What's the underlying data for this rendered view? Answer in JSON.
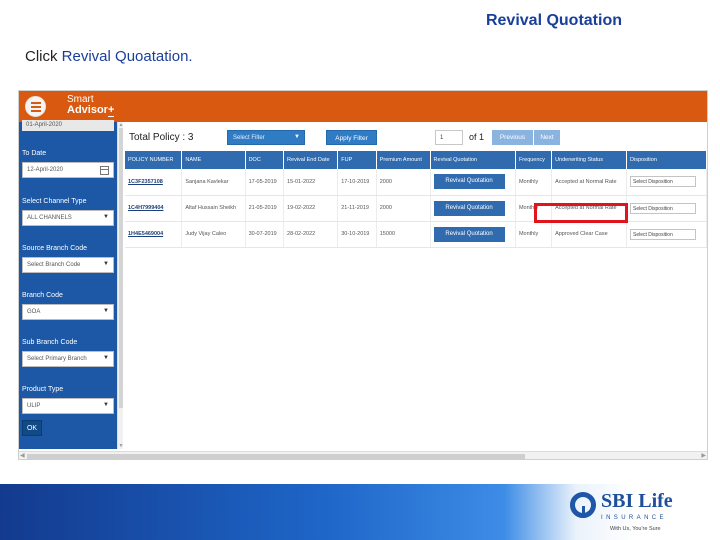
{
  "slide": {
    "title": "Revival Quotation",
    "instruction_prefix": "Click ",
    "instruction_highlight": "Revival Quoatation."
  },
  "app": {
    "brand_line1": "Smart",
    "brand_line2": "Advisor",
    "brand_plus": "+",
    "colors": {
      "topbar": "#d8590f",
      "sidebar": "#1c58a5",
      "table_header": "#2f6bae",
      "highlight": "#e0141c"
    }
  },
  "sidebar": {
    "from_date_value": "01-April-2020",
    "to_date_label": "To Date",
    "to_date_value": "12-April-2020",
    "channel_type_label": "Select Channel Type",
    "channel_type_value": "ALL CHANNELS",
    "source_branch_label": "Source Branch Code",
    "source_branch_value": "Select Branch Code",
    "branch_code_label": "Branch Code",
    "branch_code_value": "GOA",
    "sub_branch_label": "Sub Branch Code",
    "sub_branch_value": "Select Primary Branch",
    "product_type_label": "Product Type",
    "product_type_value": "ULIP",
    "ok_label": "OK"
  },
  "toolbar": {
    "total_policy": "Total Policy : 3",
    "filter_placeholder": "Select Filter",
    "apply_label": "Apply Filter",
    "page_value": "1",
    "of_text": "of 1",
    "previous_label": "Previous",
    "next_label": "Next"
  },
  "table": {
    "headers": [
      "POLICY NUMBER",
      "NAME",
      "DOC",
      "Revival End Date",
      "FUP",
      "Premium Amount",
      "Revival Quotation",
      "Frequency",
      "Underwriting Status",
      "Disposition"
    ],
    "rows": [
      {
        "policy": "1C3F2357108",
        "name": "Sanjana Kavlekar",
        "doc": "17-05-2019",
        "revival_end": "15-01-2022",
        "fup": "17-10-2019",
        "premium": "2000",
        "rq": "Revival Quotation",
        "frequency": "Monthly",
        "uw_status": "Accepted at Normal Rate",
        "disposition": "Select Disposition"
      },
      {
        "policy": "1C4H7999404",
        "name": "Altaf Hussain Sheikh",
        "doc": "21-05-2019",
        "revival_end": "19-02-2022",
        "fup": "21-11-2019",
        "premium": "2000",
        "rq": "Revival Quotation",
        "frequency": "Monthly",
        "uw_status": "Accepted at Normal Rate",
        "disposition": "Select Disposition"
      },
      {
        "policy": "1H4E5469004",
        "name": "Judy Vijay Caleo",
        "doc": "30-07-2019",
        "revival_end": "28-02-2022",
        "fup": "30-10-2019",
        "premium": "15000",
        "rq": "Revival Quotation",
        "frequency": "Monthly",
        "uw_status": "Approved Clear Case",
        "disposition": "Select Disposition"
      }
    ]
  },
  "footer": {
    "logo_name": "SBI Life",
    "logo_insurance": "INSURANCE",
    "logo_tagline": "With Us, You're Sure"
  }
}
